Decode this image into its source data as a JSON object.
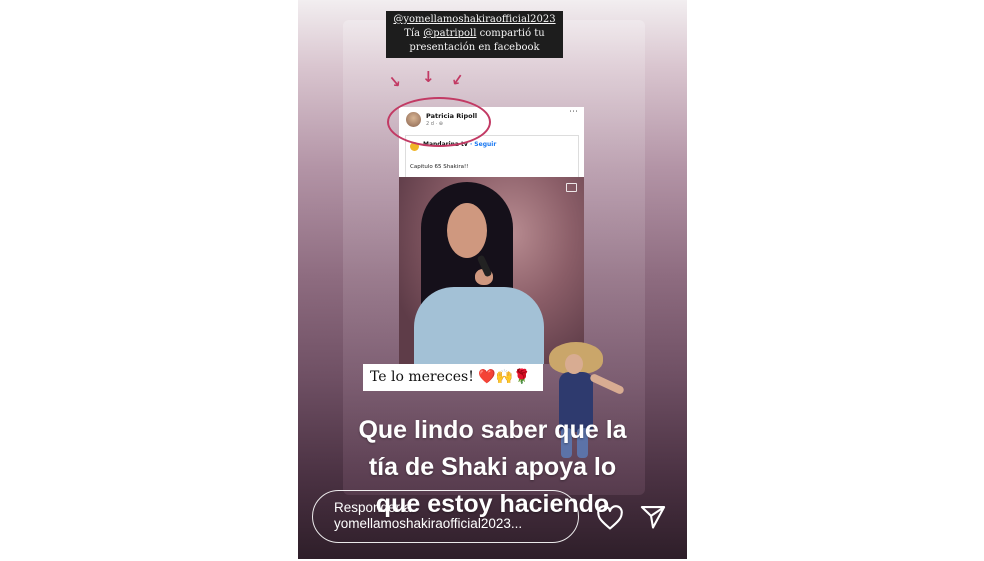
{
  "story": {
    "caption_line1": "@yomellamoshakiraofficial2023",
    "caption_line2_prefix": "Tía ",
    "caption_line2_mention": "@patripoll",
    "caption_line2_suffix": "  compartió tu",
    "caption_line3": "presentación en facebook",
    "accent_color": "#c23a64"
  },
  "facebook_post": {
    "author_name": "Patricia Ripoll",
    "author_meta": "2 d · ⊕",
    "more_icon": "⋯",
    "shared_page": "Mandarina tv",
    "shared_follow": "· Seguir",
    "shared_text": "Capitulo 65 Shakira!!"
  },
  "sticker": {
    "text": "Te lo mereces! ",
    "emojis": "❤️🙌🌹"
  },
  "overlay_text": {
    "line1": "Que lindo saber que la",
    "line2": "tía de Shaki apoya lo",
    "line3": "que estoy haciendo"
  },
  "reply": {
    "label": "Responder a",
    "username": "yomellamoshakiraofficial2023..."
  }
}
